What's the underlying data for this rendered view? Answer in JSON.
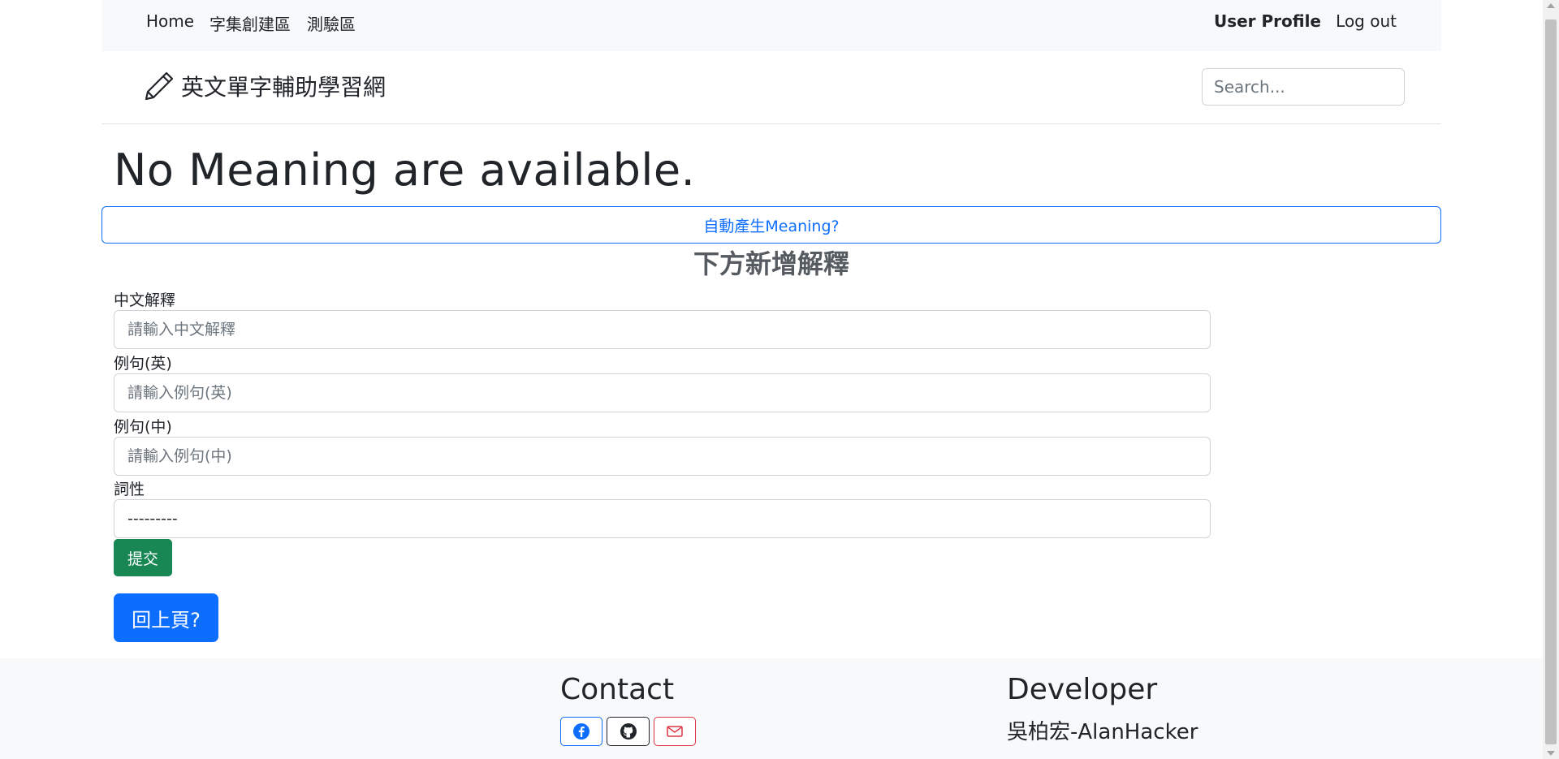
{
  "nav": {
    "home": "Home",
    "create": "字集創建區",
    "quiz": "測驗區",
    "profile": "User Profile",
    "logout": "Log out"
  },
  "brand": {
    "title": "英文單字輔助學習網",
    "icon": "pencil-icon"
  },
  "search": {
    "placeholder": "Search..."
  },
  "main": {
    "heading": "No Meaning are available.",
    "auto_button": "自動產生Meaning?",
    "subheading": "下方新增解釋"
  },
  "form": {
    "chinese_label": "中文解釋",
    "chinese_placeholder": "請輸入中文解釋",
    "example_en_label": "例句(英)",
    "example_en_placeholder": "請輸入例句(英)",
    "example_zh_label": "例句(中)",
    "example_zh_placeholder": "請輸入例句(中)",
    "pos_label": "詞性",
    "pos_selected": "---------",
    "submit": "提交"
  },
  "back_button": "回上頁?",
  "footer": {
    "contact_heading": "Contact",
    "developer_heading": "Developer",
    "developer_name": "吳柏宏-AlanHacker",
    "social_icons": [
      "facebook-icon",
      "github-icon",
      "envelope-icon"
    ]
  },
  "colors": {
    "primary": "#0d6efd",
    "success": "#198754",
    "danger": "#dc3545",
    "light_bg": "#f8f9fa"
  }
}
